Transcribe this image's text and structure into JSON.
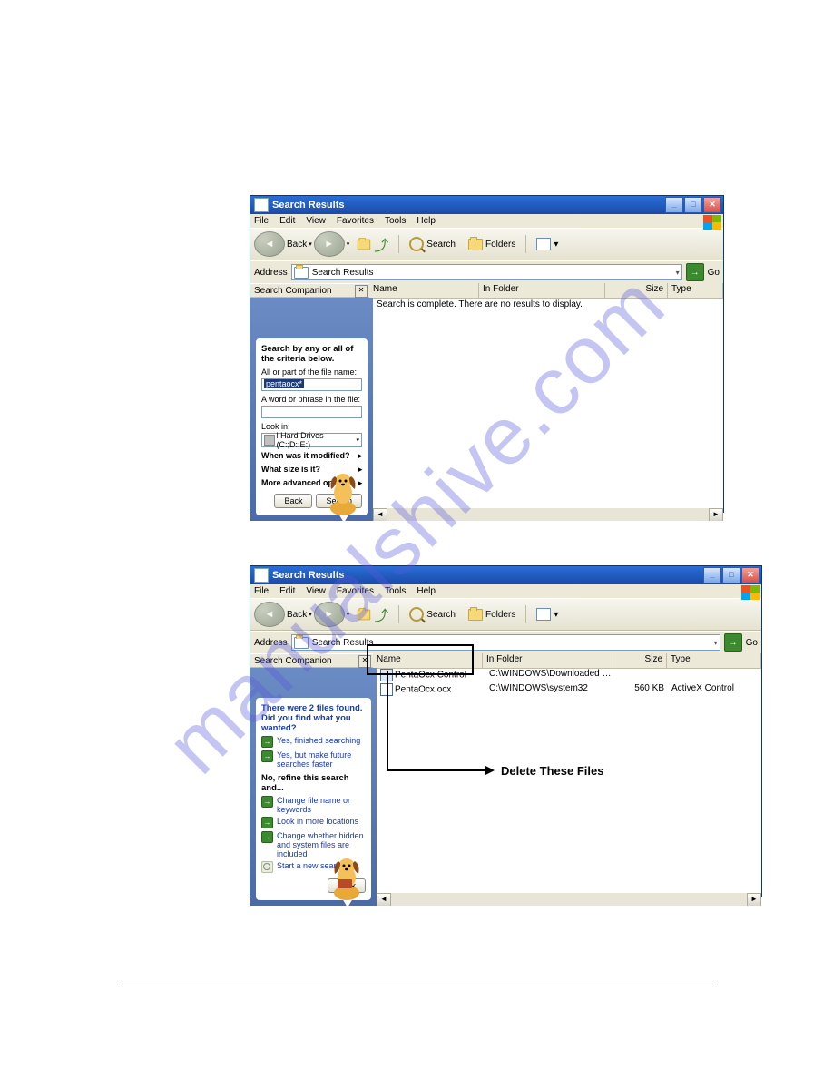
{
  "watermark": "manualshive.com",
  "menus": [
    "File",
    "Edit",
    "View",
    "Favorites",
    "Tools",
    "Help"
  ],
  "toolbar": {
    "back": "Back",
    "search": "Search",
    "folders": "Folders"
  },
  "address_label": "Address",
  "go_label": "Go",
  "companion_label": "Search Companion",
  "columns": {
    "name": "Name",
    "infolder": "In Folder",
    "size": "Size",
    "type": "Type"
  },
  "window1": {
    "title": "Search Results",
    "address": "Search Results",
    "status": "Search is complete. There are no results to display.",
    "panel": {
      "heading": "Search by any or all of the criteria below.",
      "label_name": "All or part of the file name:",
      "value_name": "pentaocx*",
      "label_phrase": "A word or phrase in the file:",
      "value_phrase": "",
      "label_lookin": "Look in:",
      "value_lookin": "l Hard Drives (C:;D:;E:)",
      "expand1": "When was it modified?",
      "expand2": "What size is it?",
      "expand3": "More advanced options",
      "btn_back": "Back",
      "btn_search": "Search"
    }
  },
  "window2": {
    "title": "Search Results",
    "address": "Search Results",
    "panel": {
      "heading": "There were 2 files found. Did you find what you wanted?",
      "link1": "Yes, finished searching",
      "link2": "Yes, but make future searches faster",
      "subhead": "No, refine this search and...",
      "link3": "Change file name or keywords",
      "link4": "Look in more locations",
      "link5": "Change whether hidden and system files are included",
      "link6": "Start a new search",
      "btn_back": "Back"
    },
    "rows": [
      {
        "icon": "ctrl",
        "name": "PentaOcx Control",
        "folder": "C:\\WINDOWS\\Downloaded Prog...",
        "size": "",
        "type": ""
      },
      {
        "icon": "file",
        "name": "PentaOcx.ocx",
        "folder": "C:\\WINDOWS\\system32",
        "size": "560 KB",
        "type": "ActiveX Control"
      }
    ],
    "annotation": "Delete These Files"
  }
}
